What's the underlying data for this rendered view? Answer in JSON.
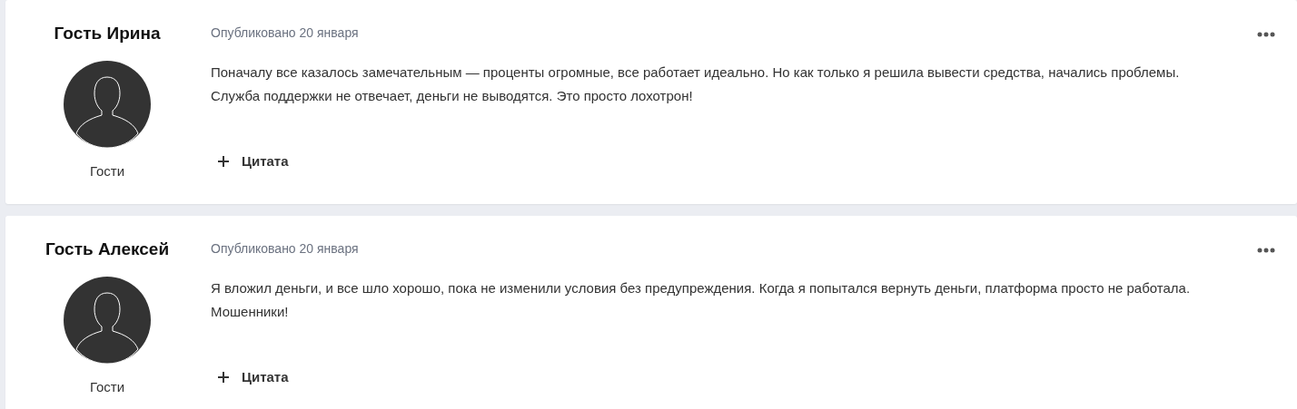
{
  "posts": [
    {
      "author": "Гость Ирина",
      "group": "Гости",
      "date": "Опубликовано 20 января",
      "text": "Поначалу все казалось замечательным — проценты огромные, все работает идеально. Но как только я решила вывести средства, начались проблемы. Служба поддержки не отвечает, деньги не выводятся. Это просто лохотрон!",
      "quote": "Цитата"
    },
    {
      "author": "Гость Алексей",
      "group": "Гости",
      "date": "Опубликовано 20 января",
      "text": "Я вложил деньги, и все шло хорошо, пока не изменили условия без предупреждения. Когда я попытался вернуть деньги, платформа просто не работала. Мошенники!",
      "quote": "Цитата"
    }
  ]
}
